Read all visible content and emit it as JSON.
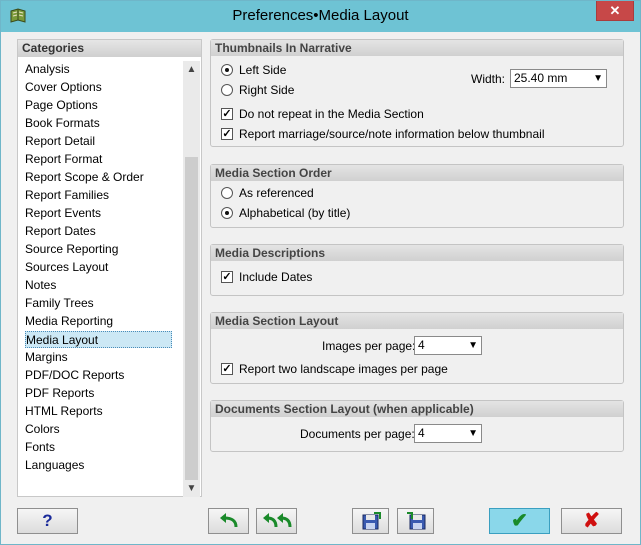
{
  "window": {
    "title": "Preferences•Media Layout",
    "close_glyph": "✕",
    "app_icon": "book-icon"
  },
  "categories": {
    "header": "Categories",
    "items": [
      "Analysis",
      "Cover Options",
      "Page Options",
      "Book Formats",
      "Report Detail",
      "Report Format",
      "Report Scope & Order",
      "Report Families",
      "Report Events",
      "Report Dates",
      "Source Reporting",
      "Sources Layout",
      "Notes",
      "Family Trees",
      "Media Reporting",
      "Media Layout",
      "Margins",
      "PDF/DOC Reports",
      "PDF Reports",
      "HTML Reports",
      "Colors",
      "Fonts",
      "Languages"
    ],
    "selected": "Media Layout"
  },
  "thumbnails": {
    "title": "Thumbnails In Narrative",
    "left_side": "Left Side",
    "right_side": "Right Side",
    "selected_side": "Left Side",
    "width_label": "Width:",
    "width_value": "25.40 mm",
    "no_repeat_label": "Do not repeat in the Media Section",
    "no_repeat_checked": true,
    "report_marriage_label": "Report marriage/source/note information below thumbnail",
    "report_marriage_checked": true
  },
  "section_order": {
    "title": "Media Section Order",
    "as_referenced": "As referenced",
    "alphabetical": "Alphabetical (by title)",
    "selected": "Alphabetical (by title)"
  },
  "descriptions": {
    "title": "Media Descriptions",
    "include_dates_label": "Include Dates",
    "include_dates_checked": true
  },
  "section_layout": {
    "title": "Media Section Layout",
    "images_per_page_label": "Images per page:",
    "images_per_page_value": "4",
    "two_landscape_label": "Report two landscape images per page",
    "two_landscape_checked": true
  },
  "documents_layout": {
    "title": "Documents Section Layout (when applicable)",
    "documents_per_page_label": "Documents per page:",
    "documents_per_page_value": "4"
  },
  "buttons": {
    "help": "?",
    "ok_glyph": "✔",
    "cancel_glyph": "✘"
  },
  "colors": {
    "titlebar": "#6ec3d4",
    "ok_button": "#8ad7ea",
    "selection": "#cce8f5",
    "help_q": "#1a2a9a",
    "ok_check": "#1a8a2a",
    "cancel_x": "#d01010"
  }
}
